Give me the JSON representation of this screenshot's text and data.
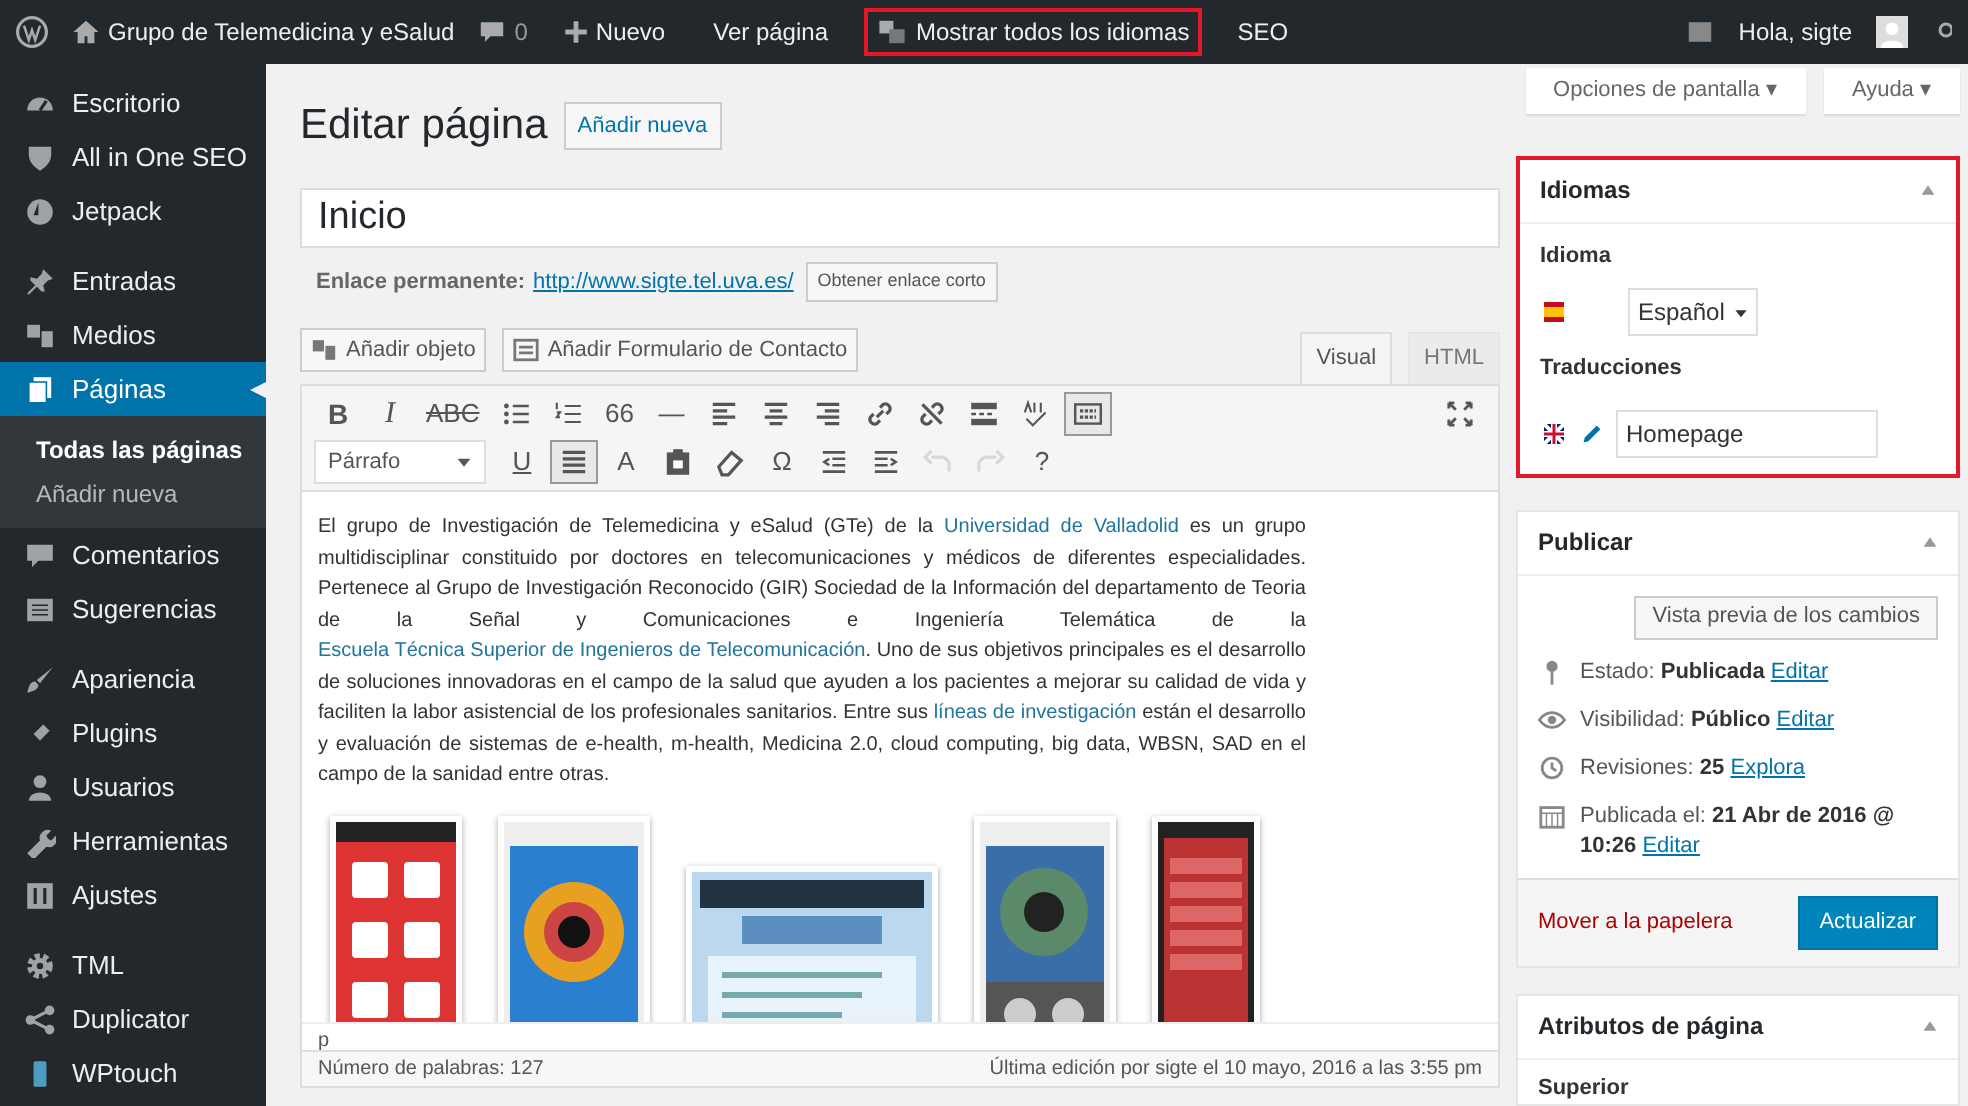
{
  "admin_bar": {
    "site": "Grupo de Telemedicina y eSalud",
    "comments": "0",
    "items": [
      {
        "label": "Nuevo",
        "highlighted": false
      },
      {
        "label": "Ver página",
        "highlighted": false
      },
      {
        "label": "Mostrar todos los idiomas",
        "highlighted": true
      },
      {
        "label": "SEO",
        "highlighted": false
      }
    ],
    "greeting": "Hola, sigte"
  },
  "sidebar": {
    "items": [
      {
        "label": "Escritorio",
        "selected": false
      },
      {
        "label": "All in One SEO",
        "selected": false
      },
      {
        "label": "Jetpack",
        "selected": false
      },
      {
        "label": "Entradas",
        "selected": false
      },
      {
        "label": "Medios",
        "selected": false
      },
      {
        "label": "Páginas",
        "selected": true,
        "children": [
          {
            "label": "Todas las páginas",
            "selected": true
          },
          {
            "label": "Añadir nueva",
            "selected": false
          }
        ]
      },
      {
        "label": "Comentarios",
        "selected": false
      },
      {
        "label": "Sugerencias",
        "selected": false
      },
      {
        "label": "Apariencia",
        "selected": false
      },
      {
        "label": "Plugins",
        "selected": false
      },
      {
        "label": "Usuarios",
        "selected": false
      },
      {
        "label": "Herramientas",
        "selected": false
      },
      {
        "label": "Ajustes",
        "selected": false
      },
      {
        "label": "TML",
        "selected": false
      },
      {
        "label": "Duplicator",
        "selected": false
      },
      {
        "label": "WPtouch",
        "selected": false
      }
    ]
  },
  "screen_buttons": [
    "Opciones de pantalla ▾",
    "Ayuda ▾"
  ],
  "editor": {
    "heading": "Editar página",
    "add_new": "Añadir nueva",
    "title": "Inicio",
    "permalink_label": "Enlace permanente:",
    "permalink": "http://www.sigte.tel.uva.es/",
    "shortlink_button": "Obtener enlace corto",
    "media_buttons": [
      "Añadir objeto",
      "Añadir Formulario de Contacto"
    ],
    "tabs": [
      {
        "label": "Visual",
        "selected": true
      },
      {
        "label": "HTML",
        "selected": false
      }
    ],
    "toolbar_1": [
      {
        "label": "B",
        "selected": false
      },
      {
        "label": "I",
        "selected": false
      },
      {
        "label": "ABC",
        "selected": false
      },
      {
        "selected": false
      },
      {
        "selected": false
      },
      {
        "label": "66",
        "selected": false
      },
      {
        "label": "—",
        "selected": false
      },
      {
        "selected": false
      },
      {
        "selected": false
      },
      {
        "selected": false
      },
      {
        "selected": false
      },
      {
        "selected": false
      },
      {
        "selected": false
      },
      {
        "selected": false
      },
      {
        "selected": true
      }
    ],
    "format": "Párrafo",
    "toolbar_2": [
      {
        "label": "U",
        "selected": false,
        "disabled": false
      },
      {
        "selected": true,
        "disabled": false
      },
      {
        "label": "A",
        "selected": false,
        "disabled": false
      },
      {
        "selected": false,
        "disabled": false
      },
      {
        "selected": false,
        "disabled": false
      },
      {
        "label": "Ω",
        "selected": false,
        "disabled": false
      },
      {
        "selected": false,
        "disabled": false
      },
      {
        "selected": false,
        "disabled": false
      },
      {
        "selected": false,
        "disabled": true
      },
      {
        "selected": false,
        "disabled": true
      },
      {
        "label": "?",
        "selected": false,
        "disabled": false
      }
    ],
    "body": [
      {
        "text": "El grupo de Investigación de Telemedicina y eSalud (GTe) de la ",
        "link": false
      },
      {
        "text": "Universidad de Valladolid",
        "link": true
      },
      {
        "text": " es un grupo multidisciplinar constituido por doctores en telecomunicaciones y médicos de diferentes especialidades. Pertenece al Grupo de Investigación Reconocido (GIR) Sociedad de la Información del departamento de Teoria de la Señal y Comunicaciones e Ingeniería Telemática de la ",
        "link": false
      },
      {
        "text": "Escuela Técnica Superior de Ingenieros de Telecomunicación",
        "link": true
      },
      {
        "text": ". Uno de sus objetivos principales es el desarrollo de soluciones innovadoras en el campo de la salud que ayuden a los pacientes a mejorar su calidad de vida y faciliten la labor asistencial de los profesionales sanitarios. Entre sus ",
        "link": false
      },
      {
        "text": "líneas de investigación",
        "link": true
      },
      {
        "text": " están el desarrollo y evaluación de sistemas de e-health, m-health, Medicina 2.0, cloud computing, big data, WBSN, SAD en el campo de la sanidad entre otras.",
        "link": false
      }
    ],
    "path": "p",
    "word_count": "Número de palabras: 127",
    "last_edit": "Última edición por sigte el 10 mayo, 2016 a las 3:55 pm"
  },
  "languages_box": {
    "title": "Idiomas",
    "highlighted": true,
    "language_label": "Idioma",
    "language": "Español",
    "translations_label": "Traducciones",
    "translation": "Homepage"
  },
  "publish_box": {
    "title": "Publicar",
    "preview": "Vista previa de los cambios",
    "rows": [
      {
        "label": "Estado:",
        "value": "Publicada",
        "link": "Editar"
      },
      {
        "label": "Visibilidad:",
        "value": "Público",
        "link": "Editar"
      },
      {
        "label": "Revisiones:",
        "value": "25",
        "link": "Explora"
      },
      {
        "label": "Publicada el:",
        "value": "21 Abr de 2016 @ 10:26",
        "link": "Editar"
      }
    ],
    "trash": "Mover a la papelera",
    "update": "Actualizar"
  },
  "attributes_box": {
    "title": "Atributos de página",
    "field_label": "Superior"
  }
}
